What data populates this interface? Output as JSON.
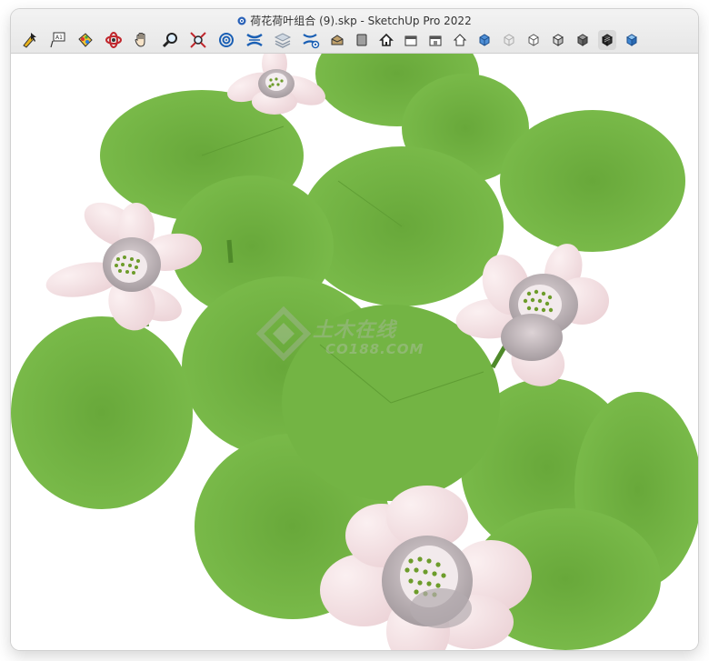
{
  "window": {
    "title": "荷花荷叶组合 (9).skp - SketchUp Pro 2022"
  },
  "toolbar": {
    "tools": [
      {
        "name": "select-tool",
        "icon": "select-arrow-icon"
      },
      {
        "name": "text-tool",
        "icon": "text-label-icon",
        "label": "A1"
      },
      {
        "name": "paint-bucket-tool",
        "icon": "paint-bucket-icon"
      },
      {
        "name": "orbit-tool",
        "icon": "orbit-icon"
      },
      {
        "name": "pan-tool",
        "icon": "hand-icon"
      },
      {
        "name": "zoom-tool",
        "icon": "magnifier-icon"
      },
      {
        "name": "zoom-extents-tool",
        "icon": "zoom-extents-icon"
      },
      {
        "name": "walk-tool",
        "icon": "walk-target-icon"
      },
      {
        "name": "section-plane-tool",
        "icon": "section-plane-icon"
      },
      {
        "name": "layers-tool",
        "icon": "layers-icon"
      },
      {
        "name": "section-settings-tool",
        "icon": "section-gear-icon"
      },
      {
        "name": "iso-view",
        "icon": "iso-house-icon"
      },
      {
        "name": "top-view",
        "icon": "top-view-icon"
      },
      {
        "name": "front-view",
        "icon": "front-view-icon"
      },
      {
        "name": "right-view",
        "icon": "right-view-icon"
      },
      {
        "name": "back-view",
        "icon": "back-view-icon"
      },
      {
        "name": "left-view",
        "icon": "left-view-icon"
      },
      {
        "name": "xray-style",
        "icon": "xray-cube-icon"
      },
      {
        "name": "wireframe-style",
        "icon": "wireframe-cube-icon"
      },
      {
        "name": "hidden-line-style",
        "icon": "hidden-line-cube-icon"
      },
      {
        "name": "shaded-style",
        "icon": "shaded-cube-icon"
      },
      {
        "name": "shaded-textures-style",
        "icon": "shaded-textures-cube-icon",
        "active": true
      },
      {
        "name": "monochrome-style",
        "icon": "monochrome-cube-icon"
      }
    ]
  },
  "watermark": {
    "text": "土木在线",
    "subtext": "CO188.COM"
  },
  "colors": {
    "leaf": "#74b544",
    "leaf_dark": "#5e9c32",
    "petal": "#f3dcdf",
    "petal_shadow": "#a79fa3",
    "stamen": "#6d9c2b"
  }
}
